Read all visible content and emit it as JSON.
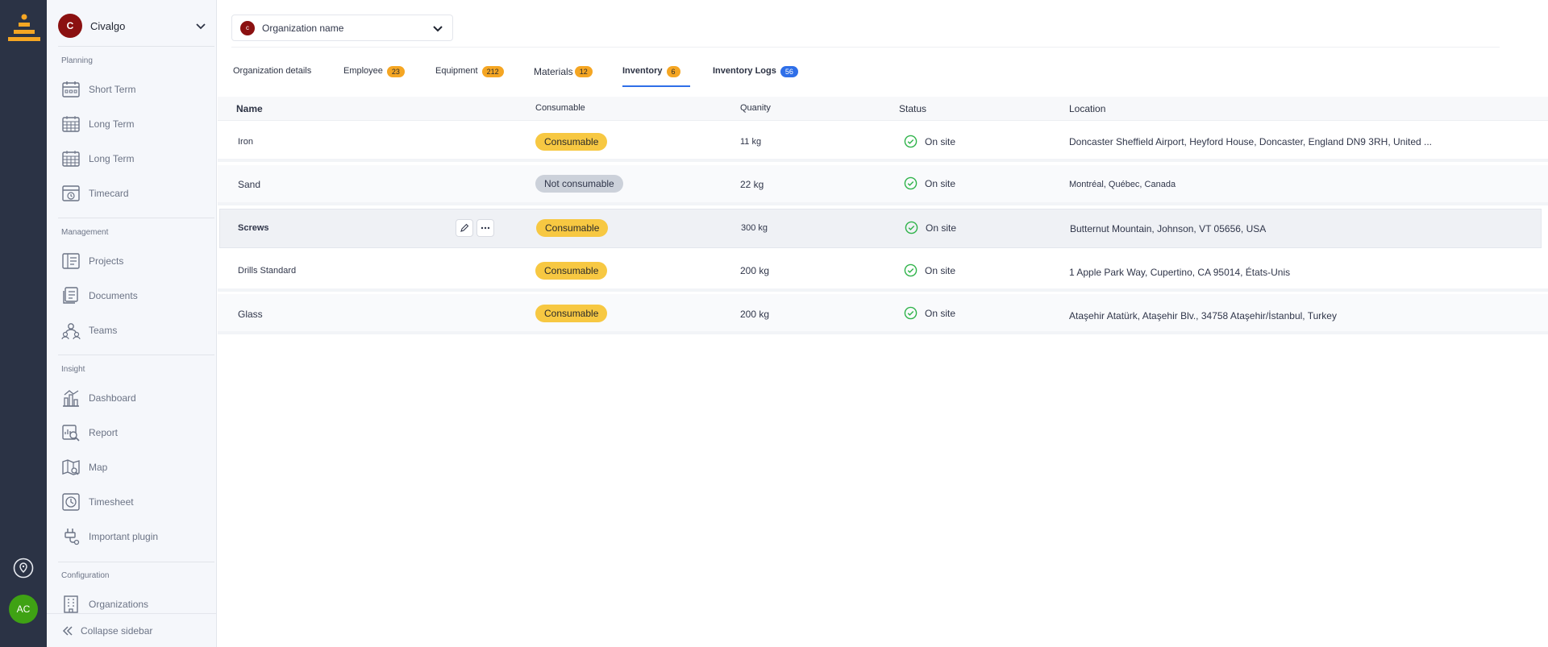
{
  "app": {
    "org_initial": "C",
    "org_name": "Civalgo",
    "user_initials": "AC"
  },
  "sidebar": {
    "sections": [
      {
        "label": "Planning",
        "items": [
          {
            "label": "Short Term",
            "icon": "calendar-icon"
          },
          {
            "label": "Long Term",
            "icon": "calendar-grid-icon"
          },
          {
            "label": "Long Term",
            "icon": "calendar-grid-icon"
          },
          {
            "label": "Timecard",
            "icon": "timecard-icon"
          }
        ]
      },
      {
        "label": "Management",
        "items": [
          {
            "label": "Projects",
            "icon": "projects-icon"
          },
          {
            "label": "Documents",
            "icon": "documents-icon"
          },
          {
            "label": "Teams",
            "icon": "teams-icon"
          }
        ]
      },
      {
        "label": "Insight",
        "items": [
          {
            "label": "Dashboard",
            "icon": "dashboard-icon"
          },
          {
            "label": "Report",
            "icon": "report-icon"
          },
          {
            "label": "Map",
            "icon": "map-icon"
          },
          {
            "label": "Timesheet",
            "icon": "clock-icon"
          },
          {
            "label": "Important plugin",
            "icon": "plugin-icon"
          }
        ]
      },
      {
        "label": "Configuration",
        "items": [
          {
            "label": "Organizations",
            "icon": "building-icon"
          }
        ]
      }
    ],
    "collapse_label": "Collapse sidebar"
  },
  "org_select": {
    "initial": "c",
    "placeholder": "Organization name"
  },
  "tabs": [
    {
      "label": "Organization details"
    },
    {
      "label": "Employee",
      "badge": "23"
    },
    {
      "label": "Equipment",
      "badge": "212"
    },
    {
      "label": "Materials",
      "badge": "12"
    },
    {
      "label": "Inventory",
      "badge": "6",
      "active": true
    },
    {
      "label": "Inventory Logs",
      "badge": "56"
    }
  ],
  "table": {
    "columns": [
      "Name",
      "Consumable",
      "Quanity",
      "Status",
      "Location"
    ],
    "rows": [
      {
        "name": "Iron",
        "consumable": "Consumable",
        "quantity": "11 kg",
        "status": "On site",
        "location": "Doncaster Sheffield Airport, Heyford House, Doncaster, England DN9 3RH, United ..."
      },
      {
        "name": "Sand",
        "consumable": "Not consumable",
        "quantity": "22 kg",
        "status": "On site",
        "location": "Montréal, Québec, Canada"
      },
      {
        "name": "Screws",
        "consumable": "Consumable",
        "quantity": "300 kg",
        "status": "On site",
        "location": "Butternut Mountain, Johnson, VT 05656, USA"
      },
      {
        "name": "Drills Standard",
        "consumable": "Consumable",
        "quantity": "200 kg",
        "status": "On site",
        "location": "1 Apple Park Way, Cupertino, CA 95014, États-Unis"
      },
      {
        "name": "Glass",
        "consumable": "Consumable",
        "quantity": "200 kg",
        "status": "On site",
        "location": "Ataşehir Atatürk, Ataşehir Blv., 34758 Ataşehir/İstanbul, Turkey"
      }
    ]
  },
  "colors": {
    "rail": "#2b3345",
    "accent": "#2f6fe8",
    "badge_orange": "#f5a623",
    "pill_yellow": "#f7c842",
    "status_green": "#2fb34a",
    "org_red": "#8b1111"
  }
}
